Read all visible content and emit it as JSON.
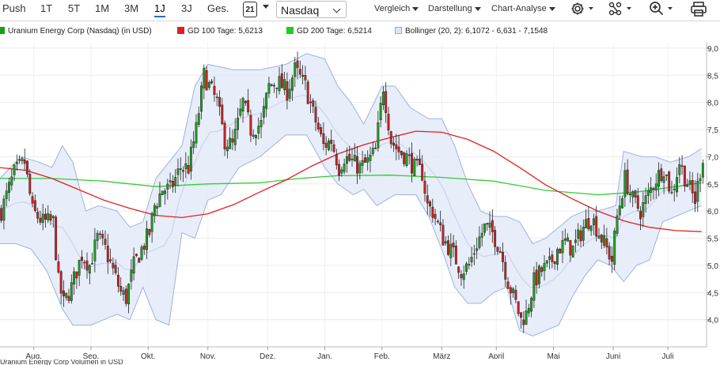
{
  "toolbar": {
    "ranges": [
      "Push",
      "1T",
      "5T",
      "1M",
      "3M",
      "1J",
      "3J",
      "Ges."
    ],
    "active_range": "1J",
    "calendar_day": "21",
    "exchange": "Nasdaq",
    "menus": [
      "Vergleich",
      "Darstellung",
      "Chart-Analyse"
    ],
    "icons": [
      "gear-icon",
      "indicators-icon",
      "zoom-icon",
      "print-icon"
    ]
  },
  "legend": [
    {
      "label": "Uranium Energy Corp (Nasdaq) (in USD)",
      "color": "#1a9e1a"
    },
    {
      "label": "GD 100 Tage: 5,6213",
      "color": "#e02020"
    },
    {
      "label": "GD 200 Tage: 6,5214",
      "color": "#22cc22"
    },
    {
      "label": "Bollinger (20, 2): 6,1072 - 6,631 - 7,1548",
      "color": "#8fa8d8"
    }
  ],
  "bottom_label": "Uranium Energy Corp Volumen in USD",
  "chart_data": {
    "type": "candlestick",
    "ylim": [
      3.5,
      9.1
    ],
    "y_ticks": [
      4.0,
      4.5,
      5.0,
      5.5,
      6.0,
      6.5,
      7.0,
      7.5,
      8.0,
      8.5,
      9.0
    ],
    "y_tick_labels": [
      "4,0",
      "4,5",
      "5,0",
      "5,5",
      "6,0",
      "6,5",
      "7,0",
      "7,5",
      "8,0",
      "8,5",
      "9,0"
    ],
    "months": [
      "Aug.",
      "Sep.",
      "Okt.",
      "Nov.",
      "Dez.",
      "Jan.",
      "Feb.",
      "März",
      "April",
      "Mai",
      "Juni",
      "Juli"
    ],
    "month_days": [
      13,
      35,
      57,
      80,
      103,
      125,
      147,
      170,
      191,
      213,
      236,
      257
    ],
    "total_days": 271,
    "close_path": [
      [
        0,
        6.0
      ],
      [
        5,
        6.7
      ],
      [
        9,
        6.9
      ],
      [
        12,
        6.0
      ],
      [
        16,
        5.8
      ],
      [
        20,
        5.8
      ],
      [
        22,
        4.7
      ],
      [
        24,
        4.3
      ],
      [
        27,
        4.6
      ],
      [
        31,
        5.2
      ],
      [
        34,
        5.0
      ],
      [
        37,
        5.5
      ],
      [
        40,
        5.3
      ],
      [
        43,
        4.9
      ],
      [
        46,
        4.5
      ],
      [
        48,
        4.4
      ],
      [
        51,
        5.0
      ],
      [
        54,
        5.3
      ],
      [
        57,
        5.6
      ],
      [
        59,
        6.1
      ],
      [
        62,
        6.4
      ],
      [
        65,
        6.4
      ],
      [
        69,
        6.8
      ],
      [
        72,
        6.8
      ],
      [
        75,
        7.5
      ],
      [
        78,
        8.5
      ],
      [
        80,
        8.3
      ],
      [
        83,
        8.0
      ],
      [
        86,
        7.3
      ],
      [
        89,
        7.2
      ],
      [
        93,
        8.0
      ],
      [
        96,
        7.5
      ],
      [
        100,
        7.6
      ],
      [
        103,
        8.3
      ],
      [
        106,
        8.4
      ],
      [
        110,
        8.2
      ],
      [
        113,
        8.6
      ],
      [
        117,
        8.3
      ],
      [
        120,
        7.8
      ],
      [
        124,
        7.2
      ],
      [
        127,
        7.3
      ],
      [
        130,
        6.8
      ],
      [
        132,
        7.0
      ],
      [
        135,
        6.9
      ],
      [
        138,
        6.8
      ],
      [
        141,
        6.9
      ],
      [
        144,
        7.1
      ],
      [
        147,
        8.3
      ],
      [
        150,
        7.3
      ],
      [
        153,
        7.1
      ],
      [
        156,
        7.0
      ],
      [
        159,
        6.8
      ],
      [
        162,
        6.7
      ],
      [
        164,
        6.1
      ],
      [
        166,
        6.0
      ],
      [
        170,
        5.5
      ],
      [
        174,
        5.2
      ],
      [
        177,
        4.9
      ],
      [
        180,
        5.0
      ],
      [
        183,
        5.4
      ],
      [
        186,
        5.7
      ],
      [
        189,
        5.6
      ],
      [
        192,
        5.3
      ],
      [
        195,
        4.7
      ],
      [
        198,
        4.3
      ],
      [
        200,
        4.0
      ],
      [
        202,
        4.1
      ],
      [
        205,
        4.7
      ],
      [
        208,
        4.9
      ],
      [
        211,
        5.0
      ],
      [
        214,
        5.3
      ],
      [
        217,
        5.4
      ],
      [
        220,
        5.3
      ],
      [
        224,
        5.7
      ],
      [
        227,
        5.9
      ],
      [
        230,
        5.6
      ],
      [
        233,
        5.3
      ],
      [
        235,
        5.1
      ],
      [
        237,
        5.9
      ],
      [
        240,
        6.6
      ],
      [
        243,
        6.2
      ],
      [
        246,
        6.0
      ],
      [
        249,
        6.3
      ],
      [
        252,
        6.6
      ],
      [
        255,
        6.8
      ],
      [
        258,
        6.3
      ],
      [
        261,
        6.9
      ],
      [
        264,
        6.5
      ],
      [
        267,
        6.2
      ],
      [
        270,
        7.0
      ]
    ],
    "ma100_path": [
      [
        0,
        6.8
      ],
      [
        10,
        6.75
      ],
      [
        20,
        6.6
      ],
      [
        30,
        6.4
      ],
      [
        40,
        6.2
      ],
      [
        50,
        6.05
      ],
      [
        60,
        5.92
      ],
      [
        70,
        5.88
      ],
      [
        80,
        5.95
      ],
      [
        90,
        6.12
      ],
      [
        100,
        6.35
      ],
      [
        110,
        6.57
      ],
      [
        120,
        6.83
      ],
      [
        130,
        7.05
      ],
      [
        140,
        7.22
      ],
      [
        150,
        7.35
      ],
      [
        160,
        7.47
      ],
      [
        170,
        7.45
      ],
      [
        180,
        7.32
      ],
      [
        190,
        7.1
      ],
      [
        200,
        6.8
      ],
      [
        210,
        6.48
      ],
      [
        220,
        6.23
      ],
      [
        230,
        6.0
      ],
      [
        240,
        5.82
      ],
      [
        250,
        5.7
      ],
      [
        260,
        5.64
      ],
      [
        270,
        5.62
      ]
    ],
    "ma200_path": [
      [
        0,
        6.6
      ],
      [
        20,
        6.6
      ],
      [
        40,
        6.55
      ],
      [
        60,
        6.45
      ],
      [
        80,
        6.5
      ],
      [
        100,
        6.52
      ],
      [
        115,
        6.6
      ],
      [
        130,
        6.65
      ],
      [
        150,
        6.66
      ],
      [
        170,
        6.62
      ],
      [
        190,
        6.55
      ],
      [
        210,
        6.38
      ],
      [
        230,
        6.3
      ],
      [
        245,
        6.35
      ],
      [
        260,
        6.45
      ],
      [
        270,
        6.52
      ]
    ],
    "boll_upper_path": [
      [
        0,
        6.6
      ],
      [
        8,
        7.0
      ],
      [
        15,
        6.9
      ],
      [
        20,
        6.8
      ],
      [
        24,
        7.2
      ],
      [
        28,
        6.9
      ],
      [
        33,
        6.0
      ],
      [
        38,
        6.1
      ],
      [
        45,
        6.0
      ],
      [
        50,
        5.7
      ],
      [
        55,
        5.8
      ],
      [
        60,
        6.6
      ],
      [
        65,
        6.9
      ],
      [
        70,
        7.2
      ],
      [
        75,
        8.3
      ],
      [
        80,
        8.7
      ],
      [
        90,
        8.6
      ],
      [
        100,
        8.6
      ],
      [
        110,
        8.7
      ],
      [
        118,
        8.9
      ],
      [
        125,
        8.8
      ],
      [
        130,
        8.3
      ],
      [
        135,
        8.0
      ],
      [
        140,
        7.6
      ],
      [
        147,
        8.3
      ],
      [
        152,
        8.3
      ],
      [
        158,
        7.9
      ],
      [
        165,
        7.7
      ],
      [
        170,
        7.7
      ],
      [
        175,
        7.2
      ],
      [
        180,
        6.5
      ],
      [
        185,
        6.0
      ],
      [
        190,
        5.9
      ],
      [
        195,
        5.9
      ],
      [
        200,
        5.8
      ],
      [
        205,
        5.4
      ],
      [
        210,
        5.5
      ],
      [
        215,
        5.7
      ],
      [
        220,
        5.9
      ],
      [
        225,
        6.0
      ],
      [
        230,
        6.0
      ],
      [
        237,
        6.1
      ],
      [
        240,
        7.1
      ],
      [
        247,
        7.0
      ],
      [
        252,
        7.0
      ],
      [
        258,
        6.9
      ],
      [
        265,
        7.0
      ],
      [
        270,
        7.15
      ]
    ],
    "boll_lower_path": [
      [
        0,
        5.4
      ],
      [
        6,
        5.4
      ],
      [
        12,
        5.3
      ],
      [
        18,
        4.9
      ],
      [
        24,
        4.2
      ],
      [
        28,
        3.9
      ],
      [
        35,
        3.9
      ],
      [
        40,
        4.0
      ],
      [
        45,
        4.1
      ],
      [
        50,
        4.0
      ],
      [
        55,
        4.6
      ],
      [
        60,
        4.0
      ],
      [
        65,
        3.9
      ],
      [
        70,
        5.6
      ],
      [
        75,
        5.5
      ],
      [
        80,
        6.2
      ],
      [
        85,
        6.3
      ],
      [
        92,
        6.8
      ],
      [
        100,
        7.0
      ],
      [
        110,
        7.4
      ],
      [
        118,
        7.4
      ],
      [
        125,
        6.8
      ],
      [
        130,
        6.5
      ],
      [
        136,
        6.3
      ],
      [
        140,
        6.4
      ],
      [
        145,
        6.1
      ],
      [
        152,
        6.3
      ],
      [
        160,
        6.3
      ],
      [
        165,
        5.9
      ],
      [
        170,
        5.3
      ],
      [
        175,
        4.6
      ],
      [
        180,
        4.3
      ],
      [
        185,
        4.3
      ],
      [
        190,
        4.5
      ],
      [
        195,
        4.6
      ],
      [
        200,
        3.8
      ],
      [
        205,
        3.7
      ],
      [
        210,
        3.8
      ],
      [
        215,
        3.9
      ],
      [
        220,
        4.4
      ],
      [
        225,
        4.8
      ],
      [
        230,
        5.1
      ],
      [
        235,
        5.0
      ],
      [
        240,
        4.7
      ],
      [
        245,
        5.0
      ],
      [
        250,
        5.1
      ],
      [
        255,
        5.8
      ],
      [
        260,
        5.9
      ],
      [
        265,
        6.0
      ],
      [
        270,
        6.1
      ]
    ]
  }
}
